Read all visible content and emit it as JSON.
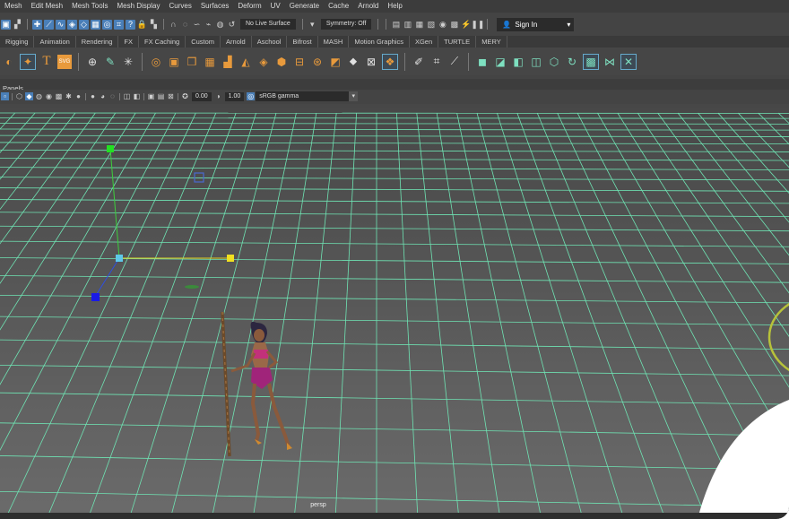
{
  "menubar": {
    "items": [
      "Mesh",
      "Edit Mesh",
      "Mesh Tools",
      "Mesh Display",
      "Curves",
      "Surfaces",
      "Deform",
      "UV",
      "Generate",
      "Cache",
      "Arnold",
      "Help"
    ]
  },
  "statusline": {
    "live_surface": "No Live Surface",
    "symmetry": "Symmetry: Off",
    "sign_in": "Sign In"
  },
  "shelf_tabs": [
    "Rigging",
    "Animation",
    "Rendering",
    "FX",
    "FX Caching",
    "Custom",
    "Arnold",
    "Aschool",
    "Bifrost",
    "MASH",
    "Motion Graphics",
    "XGen",
    "TURTLE",
    "MERY"
  ],
  "panels_label": "Panels",
  "viewport_toolbar": {
    "value_a": "0.00",
    "value_b": "1.00",
    "color_space": "sRGB gamma"
  },
  "viewport": {
    "camera_label": "persp"
  },
  "colors": {
    "grid": "#6fe3b3",
    "background_top": "#4a4a4a",
    "background_bottom": "#6a6a6a",
    "accent_blue": "#4a7fb8"
  }
}
